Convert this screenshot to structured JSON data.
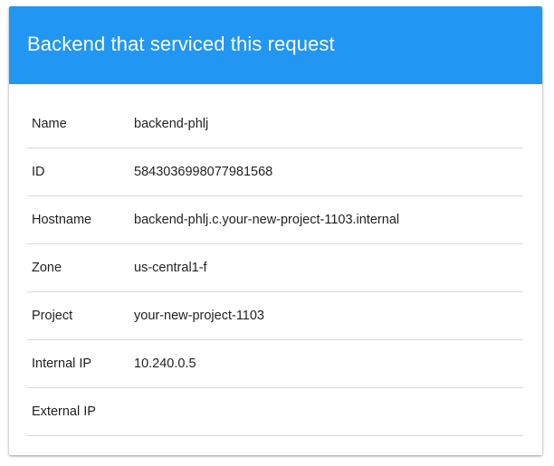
{
  "card": {
    "title": "Backend that serviced this request",
    "header_color": "#2196f3"
  },
  "rows": [
    {
      "label": "Name",
      "value": "backend-phlj"
    },
    {
      "label": "ID",
      "value": "5843036998077981568"
    },
    {
      "label": "Hostname",
      "value": "backend-phlj.c.your-new-project-1103.internal"
    },
    {
      "label": "Zone",
      "value": "us-central1-f"
    },
    {
      "label": "Project",
      "value": "your-new-project-1103"
    },
    {
      "label": "Internal IP",
      "value": "10.240.0.5"
    },
    {
      "label": "External IP",
      "value": ""
    }
  ]
}
